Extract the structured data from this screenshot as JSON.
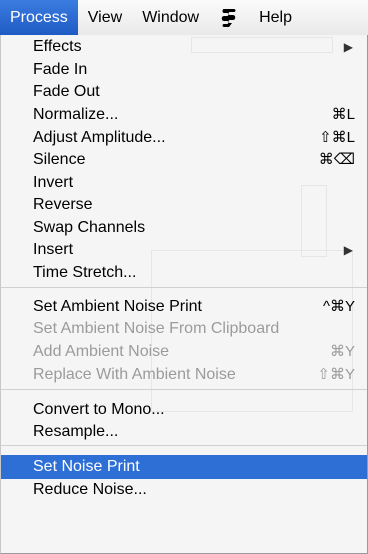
{
  "menubar": {
    "items": [
      "Process",
      "View",
      "Window",
      "Help"
    ],
    "apple_icon": "script-icon"
  },
  "menu": {
    "items": [
      {
        "label": "Effects",
        "shortcut": "",
        "submenu": true,
        "disabled": false,
        "highlighted": false
      },
      {
        "label": "Fade In",
        "shortcut": "",
        "submenu": false,
        "disabled": false,
        "highlighted": false
      },
      {
        "label": "Fade Out",
        "shortcut": "",
        "submenu": false,
        "disabled": false,
        "highlighted": false
      },
      {
        "label": "Normalize...",
        "shortcut": "⌘L",
        "submenu": false,
        "disabled": false,
        "highlighted": false
      },
      {
        "label": "Adjust Amplitude...",
        "shortcut": "⇧⌘L",
        "submenu": false,
        "disabled": false,
        "highlighted": false
      },
      {
        "label": "Silence",
        "shortcut": "⌘⌫",
        "submenu": false,
        "disabled": false,
        "highlighted": false
      },
      {
        "label": "Invert",
        "shortcut": "",
        "submenu": false,
        "disabled": false,
        "highlighted": false
      },
      {
        "label": "Reverse",
        "shortcut": "",
        "submenu": false,
        "disabled": false,
        "highlighted": false
      },
      {
        "label": "Swap Channels",
        "shortcut": "",
        "submenu": false,
        "disabled": false,
        "highlighted": false
      },
      {
        "label": "Insert",
        "shortcut": "",
        "submenu": true,
        "disabled": false,
        "highlighted": false
      },
      {
        "label": "Time Stretch...",
        "shortcut": "",
        "submenu": false,
        "disabled": false,
        "highlighted": false
      },
      {
        "label": "Set Ambient Noise Print",
        "shortcut": "^⌘Y",
        "submenu": false,
        "disabled": false,
        "highlighted": false
      },
      {
        "label": "Set Ambient Noise From Clipboard",
        "shortcut": "",
        "submenu": false,
        "disabled": true,
        "highlighted": false
      },
      {
        "label": "Add Ambient Noise",
        "shortcut": "⌘Y",
        "submenu": false,
        "disabled": true,
        "highlighted": false
      },
      {
        "label": "Replace With Ambient Noise",
        "shortcut": "⇧⌘Y",
        "submenu": false,
        "disabled": true,
        "highlighted": false
      },
      {
        "label": "Convert to Mono...",
        "shortcut": "",
        "submenu": false,
        "disabled": false,
        "highlighted": false
      },
      {
        "label": "Resample...",
        "shortcut": "",
        "submenu": false,
        "disabled": false,
        "highlighted": false
      },
      {
        "label": "Set Noise Print",
        "shortcut": "",
        "submenu": false,
        "disabled": false,
        "highlighted": true
      },
      {
        "label": "Reduce Noise...",
        "shortcut": "",
        "submenu": false,
        "disabled": false,
        "highlighted": false
      }
    ]
  },
  "colors": {
    "highlight": "#2e6fd6",
    "disabled_text": "#9b9b9b"
  }
}
